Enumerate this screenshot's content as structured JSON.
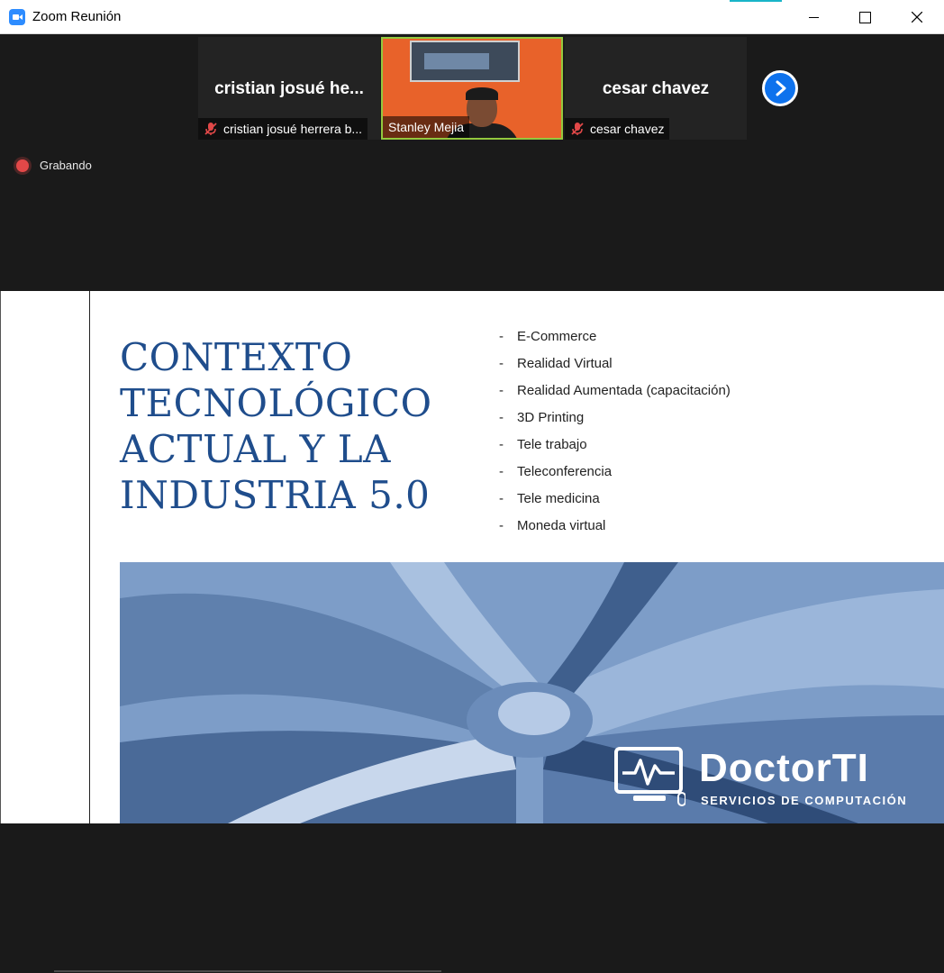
{
  "window": {
    "title": "Zoom Reunión"
  },
  "participants": [
    {
      "display_name": "cristian josué he...",
      "label": "cristian josué herrera b...",
      "muted": true
    },
    {
      "display_name": "",
      "label": "Stanley Mejia",
      "muted": false
    },
    {
      "display_name": "cesar chavez",
      "label": "cesar chavez",
      "muted": true
    }
  ],
  "recording": {
    "label": "Grabando"
  },
  "slide": {
    "title_lines": [
      "CONTEXTO",
      "TECNOLÓGICO",
      "ACTUAL Y LA",
      "INDUSTRIA 5.0"
    ],
    "bullet_marker": "-",
    "bullets": [
      "E-Commerce",
      "Realidad Virtual",
      "Realidad Aumentada (capacitación)",
      "3D Printing",
      "Tele trabajo",
      "Teleconferencia",
      "Tele medicina",
      "Moneda virtual"
    ],
    "brand": {
      "name": "DoctorTI",
      "tagline": "SERVICIOS DE COMPUTACIÓN"
    }
  },
  "colors": {
    "title_blue": "#1f4d8c",
    "zoom_blue": "#0e72ed",
    "speaker_border": "#93c83e",
    "photo_tint": "#7d9dc8"
  },
  "icons": [
    "zoom-app-icon",
    "minimize-icon",
    "maximize-icon",
    "close-icon",
    "muted-mic-icon",
    "chevron-right-icon",
    "record-dot-icon",
    "doctorti-logo-icon"
  ]
}
